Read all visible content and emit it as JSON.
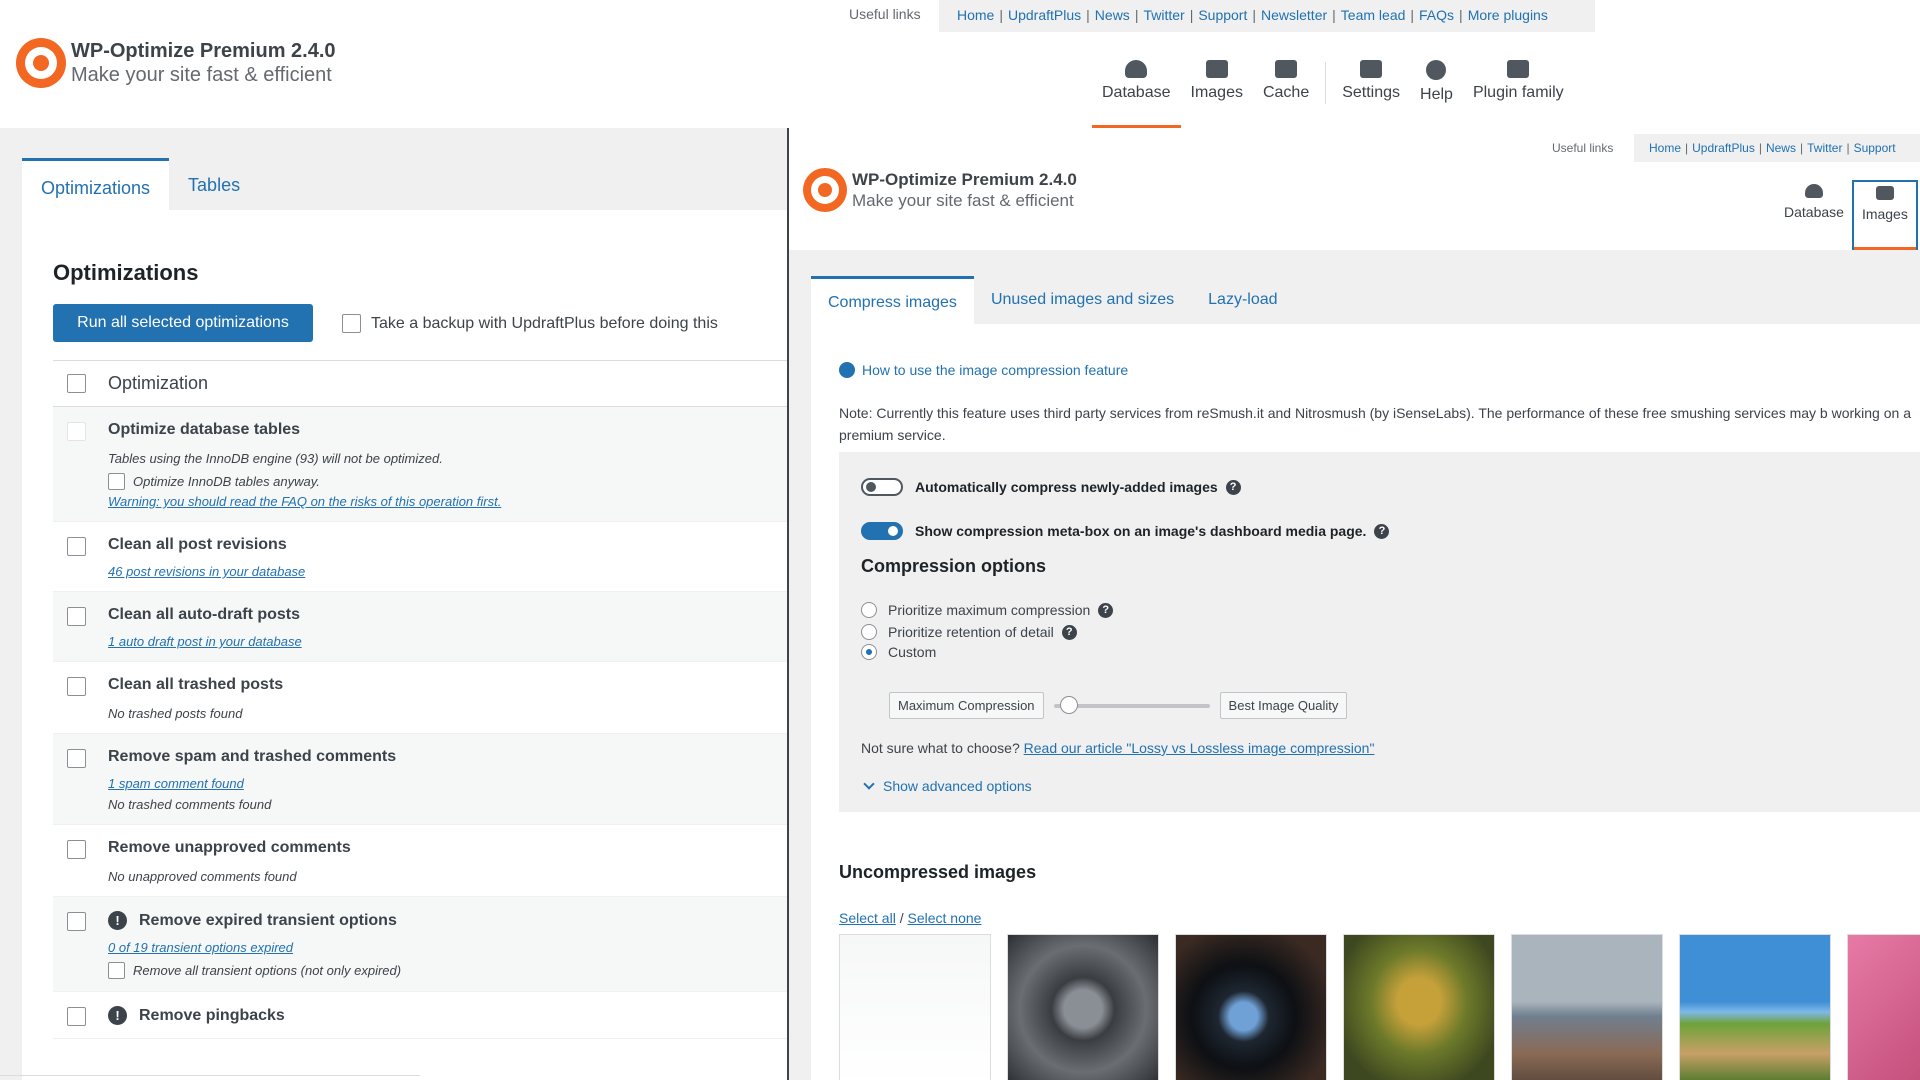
{
  "header": {
    "useful_label": "Useful links",
    "links": [
      "Home",
      "UpdraftPlus",
      "News",
      "Twitter",
      "Support",
      "Newsletter",
      "Team lead",
      "FAQs",
      "More plugins"
    ],
    "title": "WP-Optimize Premium 2.4.0",
    "subtitle": "Make your site fast & efficient",
    "nav": [
      "Database",
      "Images",
      "Cache",
      "Settings",
      "Help",
      "Plugin family"
    ]
  },
  "left": {
    "tabs": [
      "Optimizations",
      "Tables"
    ],
    "section_title": "Optimizations",
    "run_button": "Run all selected optimizations",
    "backup_label": "Take a backup with UpdraftPlus before doing this",
    "column_header": "Optimization",
    "rows": [
      {
        "title": "Optimize database tables",
        "note": "Tables using the InnoDB engine (93) will not be optimized.",
        "sub": "Optimize InnoDB tables anyway.",
        "link": "Warning: you should read the FAQ on the risks of this operation first."
      },
      {
        "title": "Clean all post revisions",
        "link": "46 post revisions in your database"
      },
      {
        "title": "Clean all auto-draft posts",
        "link": "1 auto draft post in your database"
      },
      {
        "title": "Clean all trashed posts",
        "note": "No trashed posts found"
      },
      {
        "title": "Remove spam and trashed comments",
        "link": "1 spam comment found",
        "note": "No trashed comments found"
      },
      {
        "title": "Remove unapproved comments",
        "note": "No unapproved comments found"
      },
      {
        "title": "Remove expired transient options",
        "link": "0 of 19 transient options expired",
        "sub": "Remove all transient options (not only expired)"
      },
      {
        "title": "Remove pingbacks"
      }
    ]
  },
  "right": {
    "useful_label": "Useful links",
    "links": [
      "Home",
      "UpdraftPlus",
      "News",
      "Twitter",
      "Support"
    ],
    "title": "WP-Optimize Premium 2.4.0",
    "subtitle": "Make your site fast & efficient",
    "nav": [
      "Database",
      "Images"
    ],
    "tabs": [
      "Compress images",
      "Unused images and sizes",
      "Lazy-load"
    ],
    "howto": "How to use the image compression feature",
    "note": "Note: Currently this feature uses third party services from reSmush.it and Nitrosmush (by iSenseLabs). The performance of these free smushing services may b working on a premium service.",
    "toggle_auto": "Automatically compress newly-added images",
    "toggle_auto_on": false,
    "toggle_meta": "Show compression meta-box on an image's dashboard media page.",
    "toggle_meta_on": true,
    "compression_title": "Compression options",
    "radio_max": "Prioritize maximum compression",
    "radio_detail": "Prioritize retention of detail",
    "radio_custom": "Custom",
    "slider_min_label": "Maximum Compression",
    "slider_max_label": "Best Image Quality",
    "slider_value": 0.1,
    "not_sure_text": "Not sure what to choose?",
    "not_sure_link": "Read our article \"Lossy vs Lossless image compression\"",
    "advanced": "Show advanced options",
    "uncompressed_title": "Uncompressed images",
    "select_all": "Select all",
    "select_none": "Select none"
  }
}
